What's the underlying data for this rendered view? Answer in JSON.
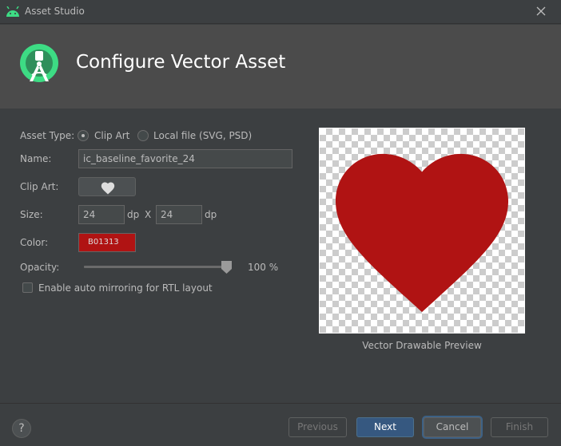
{
  "window": {
    "title": "Asset Studio",
    "close_icon": "close-icon",
    "app_icon": "android-icon"
  },
  "header": {
    "title": "Configure Vector Asset",
    "logo_icon": "android-studio-logo-icon"
  },
  "form": {
    "asset_type": {
      "label": "Asset Type:",
      "options": [
        "Clip Art",
        "Local file (SVG, PSD)"
      ],
      "selected": "Clip Art"
    },
    "name": {
      "label": "Name:",
      "value": "ic_baseline_favorite_24"
    },
    "clip_art": {
      "label": "Clip Art:",
      "icon": "heart-icon"
    },
    "size": {
      "label": "Size:",
      "width": "24",
      "height": "24",
      "unit": "dp",
      "separator": "X"
    },
    "color": {
      "label": "Color:",
      "value": "B01313",
      "hex": "#B01313"
    },
    "opacity": {
      "label": "Opacity:",
      "value_text": "100 %",
      "value": 1.0
    },
    "rtl_mirroring": {
      "label": "Enable auto mirroring for RTL layout",
      "checked": false
    }
  },
  "preview": {
    "caption": "Vector Drawable Preview",
    "icon": "heart-icon",
    "fill": "#B01313"
  },
  "footer": {
    "help_label": "?",
    "previous_label": "Previous",
    "next_label": "Next",
    "cancel_label": "Cancel",
    "finish_label": "Finish"
  },
  "colors": {
    "background": "#3c3f41",
    "header": "#4b4b4b",
    "accent": "#365880",
    "heart": "#B01313"
  }
}
